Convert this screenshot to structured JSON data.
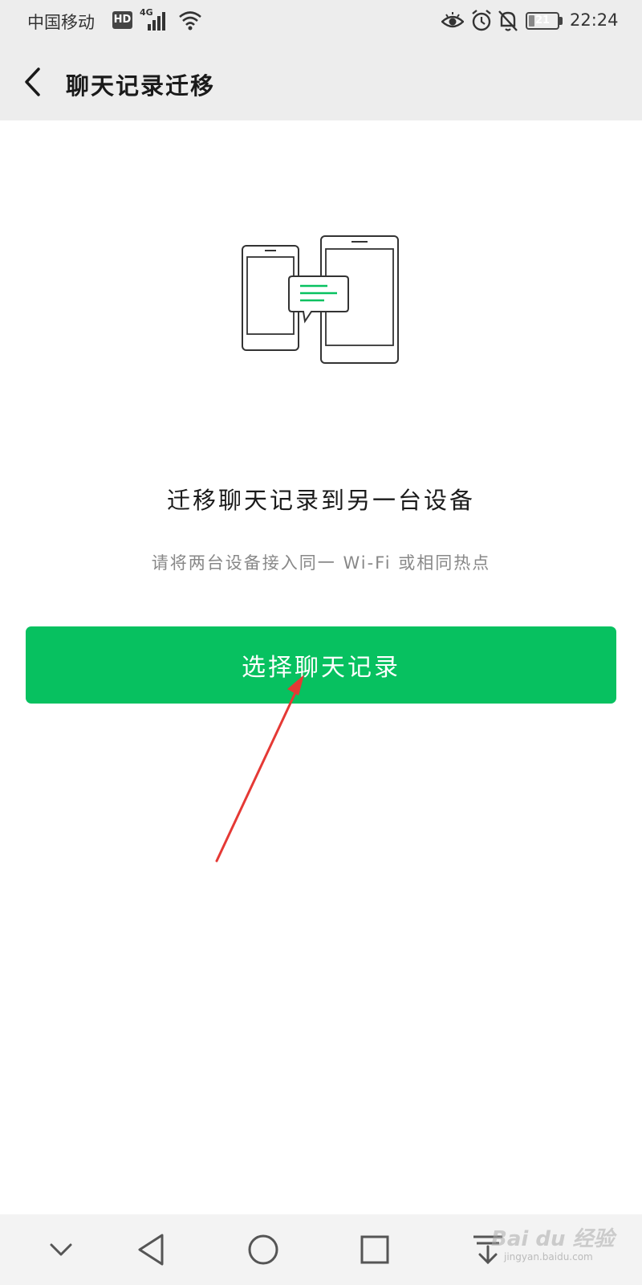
{
  "status_bar": {
    "carrier": "中国移动",
    "hd_badge": "HD",
    "network_type": "4G",
    "battery_level": "21",
    "battery_fraction": 0.21,
    "time": "22:24"
  },
  "header": {
    "title": "聊天记录迁移",
    "back_icon": "chevron-left-icon"
  },
  "main": {
    "illustration_icon": "phone-transfer-illustration",
    "headline": "迁移聊天记录到另一台设备",
    "subtext": "请将两台设备接入同一 Wi-Fi 或相同热点",
    "primary_button_label": "选择聊天记录"
  },
  "nav_bar": {
    "icons": [
      "chevron-down-icon",
      "back-triangle-icon",
      "home-circle-icon",
      "recents-square-icon",
      "download-icon"
    ]
  },
  "watermark": {
    "text": "Bai du 经验",
    "sub": "jingyan.baidu.com"
  },
  "colors": {
    "accent": "#07c160",
    "arrow": "#e53935",
    "header_bg": "#ededed"
  }
}
